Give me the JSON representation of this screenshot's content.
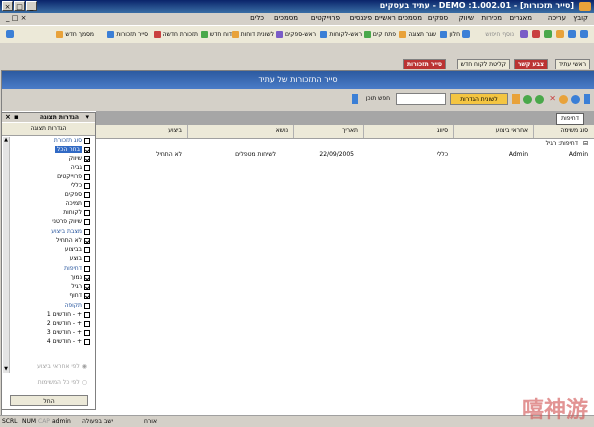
{
  "titlebar": {
    "title": "עתיד בעסקים - DEMO :1.002.01 - [סייר תזכורות]",
    "controls": [
      "_",
      "□",
      "×"
    ]
  },
  "menubar": {
    "items": [
      "קובץ",
      "עריכה",
      "מאגרים",
      "מכירות",
      "שיווק",
      "ספקים",
      "מסמכים ראשיים",
      "פיננסים",
      "פרוייקטים",
      "מסמכים",
      "כלים"
    ]
  },
  "toolbar": {
    "buttons": [
      "חלון",
      "שגר תצוגה",
      "פתח קים",
      "ראש-לקוחות",
      "ראש-ספקים",
      "לשונית דוחות",
      "דוח חדש",
      "תזכורת חדשה",
      "סייר תזכורות",
      "מסמך חדש"
    ],
    "search_hint": "נוסף חיפוש",
    "accent_colors": [
      "#3b7fd6",
      "#e8a23a",
      "#4aa84a",
      "#c94040",
      "#7a5cc7"
    ]
  },
  "tabs": {
    "items": [
      "ראשי עתיד",
      "צבע קשר",
      "קליטת לקוח חדש",
      "סייר תזכורות"
    ],
    "active": "סייר תזכורות"
  },
  "main": {
    "window_title": "סייר התזכורות של עתיד",
    "search": {
      "label": "חפש תוכן",
      "value": "",
      "settings_tab": "לשונית הגדרות"
    },
    "group_tag": "דחיפות",
    "columns": [
      "סוג משימה",
      "אחראי ביצוע",
      "סיווג",
      "תאריך",
      "נושא",
      "ביצוע"
    ],
    "group_row_label": "דחיפות: רגיל",
    "rows": [
      {
        "type": "Admin",
        "owner": "Admin",
        "category": "כללי",
        "date": "22/09/2005",
        "subject": "לשיחות מטפלים",
        "status": "לא התחיל"
      }
    ]
  },
  "sidebar": {
    "header": "הגדרות תצוגה",
    "subheader": "הגדרות תצוגה",
    "items": [
      {
        "label": "סוג תזכורת",
        "checked": false,
        "group": true
      },
      {
        "label": "בחר הכל",
        "checked": true,
        "group": false,
        "highlight": true
      },
      {
        "label": "שיווק",
        "checked": true,
        "group": false
      },
      {
        "label": "גביה",
        "checked": false,
        "group": false
      },
      {
        "label": "פרוייקטים",
        "checked": false,
        "group": false
      },
      {
        "label": "כללי",
        "checked": false,
        "group": false
      },
      {
        "label": "ספקים",
        "checked": false,
        "group": false
      },
      {
        "label": "תמיכה",
        "checked": false,
        "group": false
      },
      {
        "label": "לקוחות",
        "checked": false,
        "group": false
      },
      {
        "label": "שיווק פרטני",
        "checked": false,
        "group": false
      },
      {
        "label": "מצבת ביצוע",
        "checked": false,
        "group": true
      },
      {
        "label": "לא התחיל",
        "checked": true,
        "group": false
      },
      {
        "label": "בביצוע",
        "checked": false,
        "group": false
      },
      {
        "label": "בוצע",
        "checked": false,
        "group": false
      },
      {
        "label": "דחיפות",
        "checked": false,
        "group": true
      },
      {
        "label": "נמוך",
        "checked": true,
        "group": false
      },
      {
        "label": "רגיל",
        "checked": true,
        "group": false
      },
      {
        "label": "דחוף",
        "checked": true,
        "group": false
      },
      {
        "label": "תקופה",
        "checked": false,
        "group": true
      },
      {
        "label": "1 חודשים - +",
        "checked": false,
        "group": false
      },
      {
        "label": "2 חודשים - +",
        "checked": false,
        "group": false
      },
      {
        "label": "3 חודשים - +",
        "checked": false,
        "group": false
      },
      {
        "label": "4 חודשים - +",
        "checked": false,
        "group": false
      }
    ],
    "radio1": "לפי אחראי ביצוע",
    "radio2": "לפי כל המשימות",
    "apply_button": "החל"
  },
  "statusbar": {
    "items": [
      "SCRL",
      "NUM",
      "CAP",
      "admin",
      "ישב בפעולה",
      "אורח"
    ]
  },
  "watermark": "嘻神游"
}
